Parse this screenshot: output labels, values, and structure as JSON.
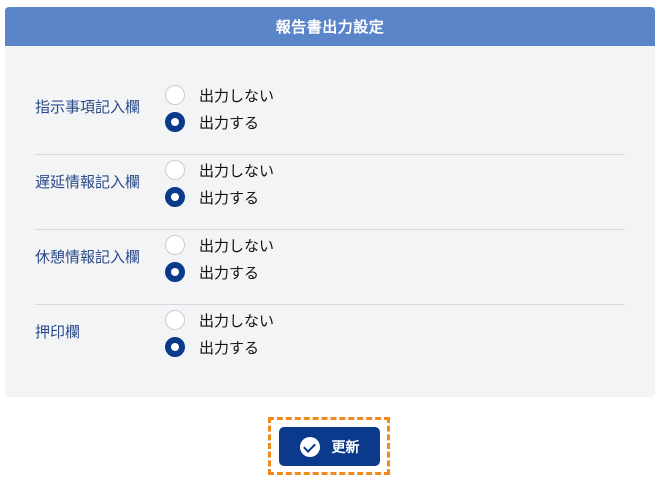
{
  "header": {
    "title": "報告書出力設定"
  },
  "settings": [
    {
      "label": "指示事項記入欄",
      "options": [
        {
          "label": "出力しない",
          "selected": false
        },
        {
          "label": "出力する",
          "selected": true
        }
      ]
    },
    {
      "label": "遅延情報記入欄",
      "options": [
        {
          "label": "出力しない",
          "selected": false
        },
        {
          "label": "出力する",
          "selected": true
        }
      ]
    },
    {
      "label": "休憩情報記入欄",
      "options": [
        {
          "label": "出力しない",
          "selected": false
        },
        {
          "label": "出力する",
          "selected": true
        }
      ]
    },
    {
      "label": "押印欄",
      "options": [
        {
          "label": "出力しない",
          "selected": false
        },
        {
          "label": "出力する",
          "selected": true
        }
      ]
    }
  ],
  "actions": {
    "update_label": "更新",
    "update_icon": "check-circle-icon"
  },
  "colors": {
    "header_bg": "#5b85c9",
    "accent": "#0b3a8c",
    "focus_outline": "#f08a1a"
  }
}
